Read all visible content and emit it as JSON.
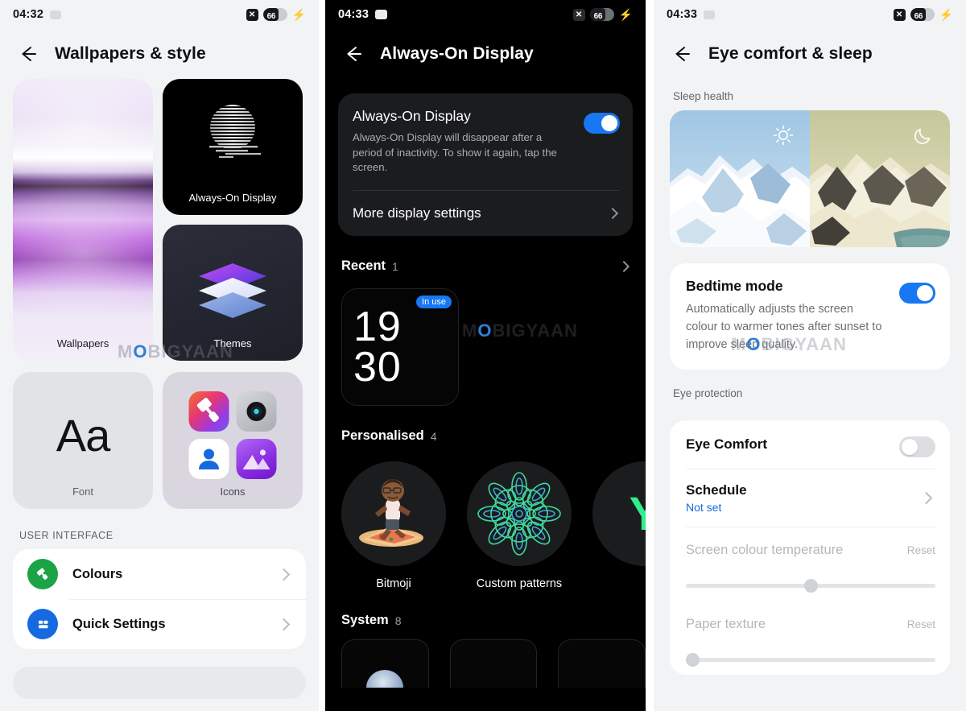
{
  "status_bar": {
    "left_time": "04:32",
    "mid_time": "04:33",
    "right_time": "04:33",
    "battery_percent": "66",
    "no_sim_glyph": "✕",
    "charging_glyph": "⚡"
  },
  "watermark": {
    "pre": "M",
    "o": "O",
    "post": "BIGYAAN"
  },
  "left_panel": {
    "title": "Wallpapers & style",
    "tiles": [
      {
        "label": "Wallpapers",
        "name": "wallpapers"
      },
      {
        "label": "Always-On Display",
        "name": "always-on-display"
      },
      {
        "label": "Themes",
        "name": "themes"
      },
      {
        "label": "Font",
        "name": "font",
        "sample": "Aa"
      },
      {
        "label": "Icons",
        "name": "icons"
      }
    ],
    "section_label": "USER INTERFACE",
    "rows": [
      {
        "label": "Colours",
        "icon": "paint-roller-icon",
        "color": "#1ba345"
      },
      {
        "label": "Quick Settings",
        "icon": "quick-settings-icon",
        "color": "#1769e0"
      }
    ]
  },
  "mid_panel": {
    "title": "Always-On Display",
    "card": {
      "title": "Always-On Display",
      "subtitle": "Always-On Display will disappear after a period of inactivity. To show it again, tap the screen.",
      "toggle_state": "on",
      "more_label": "More display settings"
    },
    "recent": {
      "title": "Recent",
      "count": "1",
      "item_badge": "In use",
      "clock_hours": "19",
      "clock_minutes": "30"
    },
    "personalised": {
      "title": "Personalised",
      "count": "4",
      "items": [
        {
          "label": "Bitmoji",
          "icon": "bitmoji-avatar-icon"
        },
        {
          "label": "Custom patterns",
          "icon": "mandala-pattern-icon"
        },
        {
          "label": "Y",
          "icon": "letter-y-icon"
        }
      ]
    },
    "system": {
      "title": "System",
      "count": "8"
    }
  },
  "right_panel": {
    "title": "Eye comfort & sleep",
    "sections": [
      {
        "label": "Sleep health"
      },
      {
        "label": "Eye protection"
      }
    ],
    "hero": {
      "day_icon": "sun-icon",
      "night_icon": "moon-icon"
    },
    "bedtime": {
      "title": "Bedtime mode",
      "subtitle": "Automatically adjusts the screen colour to warmer tones after sunset to improve sleep quality.",
      "toggle_state": "on"
    },
    "eye_comfort": {
      "label": "Eye Comfort",
      "toggle_state": "off"
    },
    "schedule": {
      "label": "Schedule",
      "value": "Not set"
    },
    "screen_temp": {
      "label": "Screen colour temperature",
      "reset": "Reset",
      "value_percent": 50
    },
    "paper_texture": {
      "label": "Paper texture",
      "reset": "Reset",
      "value_percent": 0
    }
  }
}
